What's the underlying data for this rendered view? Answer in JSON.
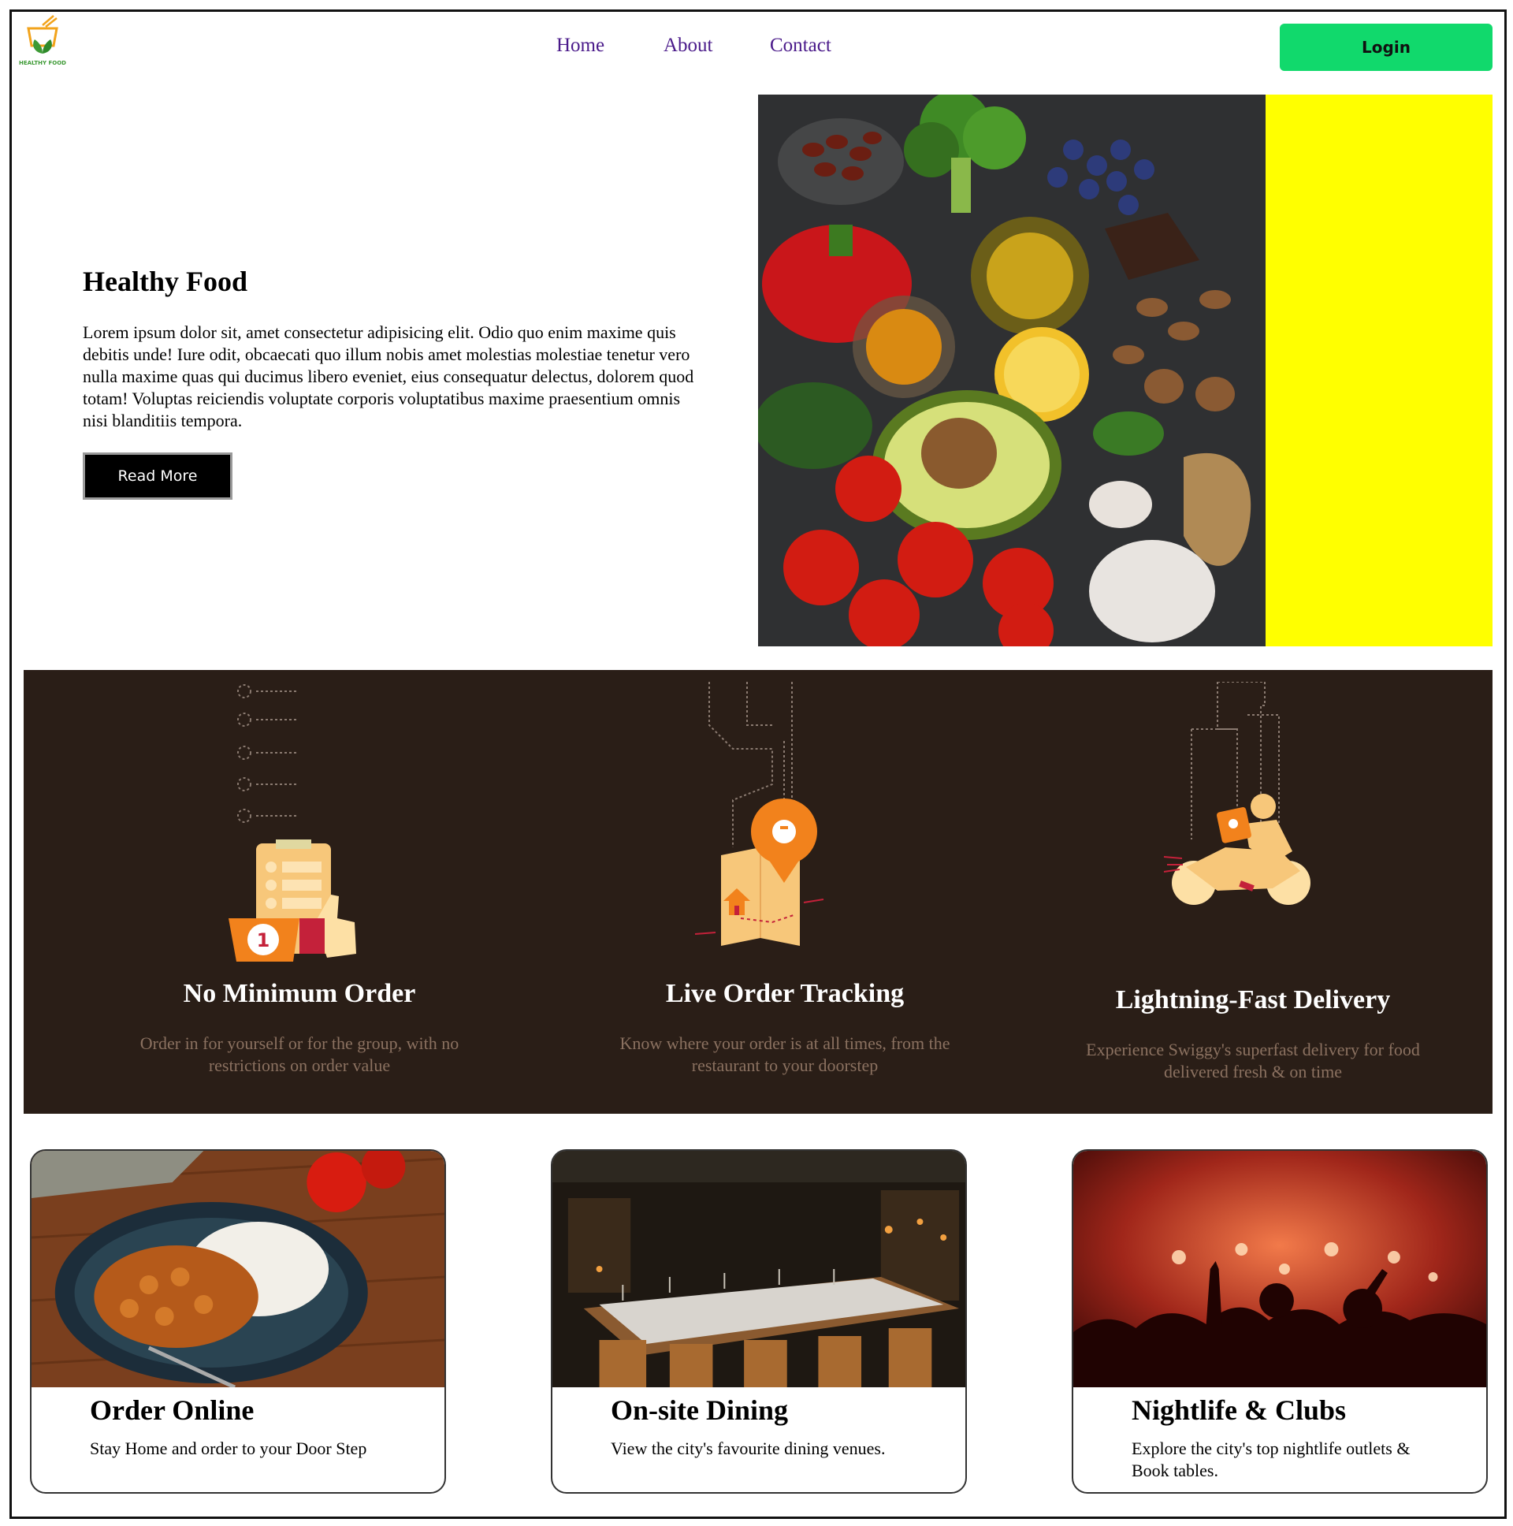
{
  "brand": {
    "logo_text": "HEALTHY FOOD"
  },
  "nav": {
    "home": "Home",
    "about": "About",
    "contact": "Contact",
    "login": "Login"
  },
  "hero": {
    "title": "Healthy Food",
    "text": "Lorem ipsum dolor sit, amet consectetur adipisicing elit. Odio quo enim maxime quis debitis unde! Iure odit, obcaecati quo illum nobis amet molestias molestiae tenetur vero nulla maxime quas qui ducimus libero eveniet, eius consequatur delectus, dolorem quod totam! Voluptas reiciendis voluptate corporis voluptatibus maxime praesentium omnis nisi blanditiis tempora.",
    "button": "Read More"
  },
  "features": [
    {
      "title": "No Minimum Order",
      "text": "Order in for yourself or for the group, with no restrictions on order value",
      "icon": "order-clipboard-icon"
    },
    {
      "title": "Live Order Tracking",
      "text": "Know where your order is at all times, from the restaurant to your doorstep",
      "icon": "map-location-icon"
    },
    {
      "title": "Lightning-Fast Delivery",
      "text": "Experience Swiggy's superfast delivery for food delivered fresh & on time",
      "icon": "delivery-scooter-icon"
    }
  ],
  "cards": [
    {
      "title": "Order Online",
      "text": "Stay Home and order to your Door Step"
    },
    {
      "title": "On-site Dining",
      "text": "View the city's favourite dining venues."
    },
    {
      "title": "Nightlife & Clubs",
      "text": "Explore the city's top nightlife outlets & Book tables."
    }
  ],
  "colors": {
    "login": "#11d96c",
    "features_bg": "#2a1e17",
    "accent_yellow": "#ffff00",
    "nav_link": "#4a1a8a"
  }
}
